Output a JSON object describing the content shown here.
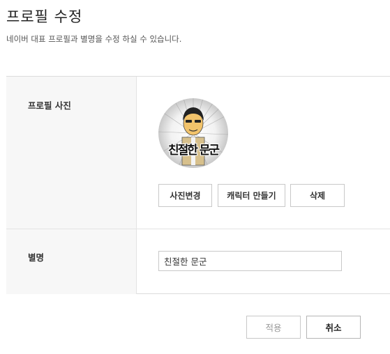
{
  "header": {
    "title": "프로필 수정",
    "description": "네이버 대표 프로필과 별명을 수정 하실 수 있습니다."
  },
  "profile_photo": {
    "label": "프로필 사진",
    "avatar_text": "친절한 문군",
    "buttons": {
      "change": "사진변경",
      "character": "캐릭터 만들기",
      "delete": "삭제"
    }
  },
  "nickname": {
    "label": "별명",
    "value": "친절한 문군"
  },
  "actions": {
    "apply": "적용",
    "cancel": "취소"
  }
}
